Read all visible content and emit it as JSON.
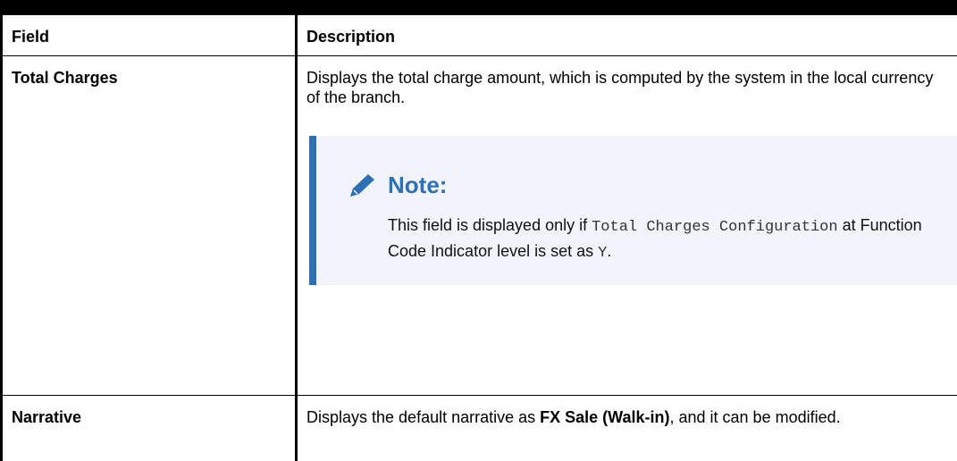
{
  "table": {
    "headers": [
      "Field",
      "Description"
    ],
    "rows": [
      {
        "field": "Total Charges",
        "description": "Displays the total charge amount, which is computed by the system in the local currency of the branch.",
        "note": {
          "icon": "pencil-icon",
          "title": "Note:",
          "text_before": "This field is displayed only if ",
          "code1": "Total Charges Configuration",
          "text_middle": " at Function Code Indicator level is set as ",
          "code2": "Y",
          "text_after": "."
        }
      },
      {
        "field": "Narrative",
        "desc_before": "Displays the default narrative as ",
        "desc_bold": "FX Sale (Walk-in)",
        "desc_after": ", and it can be modified."
      }
    ]
  },
  "colors": {
    "note_accent": "#2f6fb5",
    "note_background": "#f1f5fb"
  }
}
